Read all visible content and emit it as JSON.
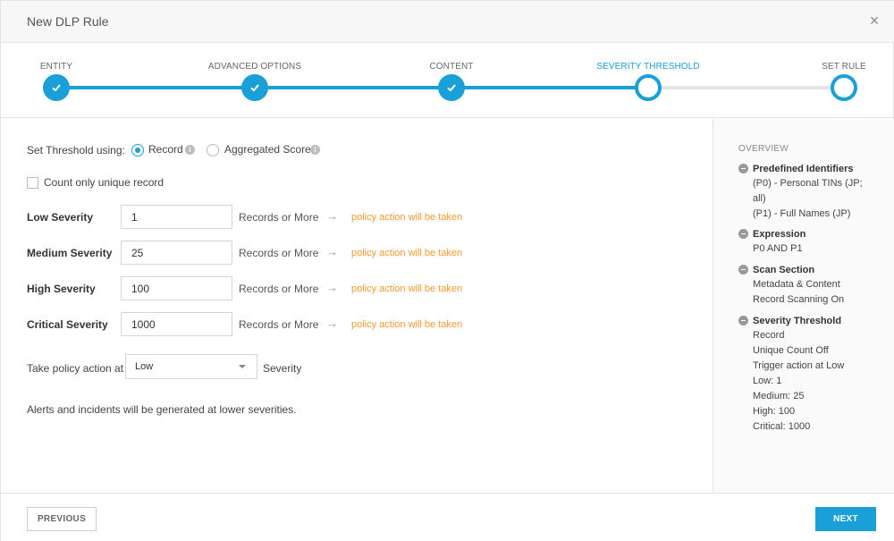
{
  "modal": {
    "title": "New DLP Rule",
    "close_icon": "×"
  },
  "stepper": {
    "steps": [
      {
        "label": "ENTITY",
        "state": "done"
      },
      {
        "label": "ADVANCED OPTIONS",
        "state": "done"
      },
      {
        "label": "CONTENT",
        "state": "done"
      },
      {
        "label": "SEVERITY THRESHOLD",
        "state": "current"
      },
      {
        "label": "SET RULE",
        "state": "todo"
      }
    ],
    "accent_color": "#1aa0d8"
  },
  "form": {
    "threshold_label": "Set Threshold using:",
    "options": [
      {
        "label": "Record",
        "selected": true
      },
      {
        "label": "Aggregated Score",
        "selected": false
      }
    ],
    "unique_label": "Count only unique record",
    "unique_checked": false,
    "severities": [
      {
        "label": "Low Severity",
        "value": "1",
        "unit": "Records or More",
        "action": "policy action will be taken"
      },
      {
        "label": "Medium Severity",
        "value": "25",
        "unit": "Records or More",
        "action": "policy action will be taken"
      },
      {
        "label": "High Severity",
        "value": "100",
        "unit": "Records or More",
        "action": "policy action will be taken"
      },
      {
        "label": "Critical Severity",
        "value": "1000",
        "unit": "Records or More",
        "action": "policy action will be taken"
      }
    ],
    "take_action_label": "Take policy action at",
    "take_action_value": "Low",
    "severity_word": "Severity",
    "alerts_note": "Alerts and incidents will be generated at lower severities.",
    "action_color": "#f39a2e"
  },
  "overview": {
    "title": "OVERVIEW",
    "sections": [
      {
        "heading": "Predefined Identifiers",
        "lines": [
          "(P0) - Personal TINs (JP;",
          "all)",
          "(P1) - Full Names (JP)"
        ]
      },
      {
        "heading": "Expression",
        "lines": [
          "P0 AND P1"
        ]
      },
      {
        "heading": "Scan Section",
        "lines": [
          "Metadata & Content",
          "Record Scanning On"
        ]
      },
      {
        "heading": "Severity Threshold",
        "lines": [
          "Record",
          "Unique Count Off",
          "Trigger action at Low",
          "Low: 1",
          "Medium: 25",
          "High: 100",
          "Critical: 1000"
        ]
      }
    ]
  },
  "footer": {
    "previous_label": "PREVIOUS",
    "next_label": "NEXT"
  }
}
